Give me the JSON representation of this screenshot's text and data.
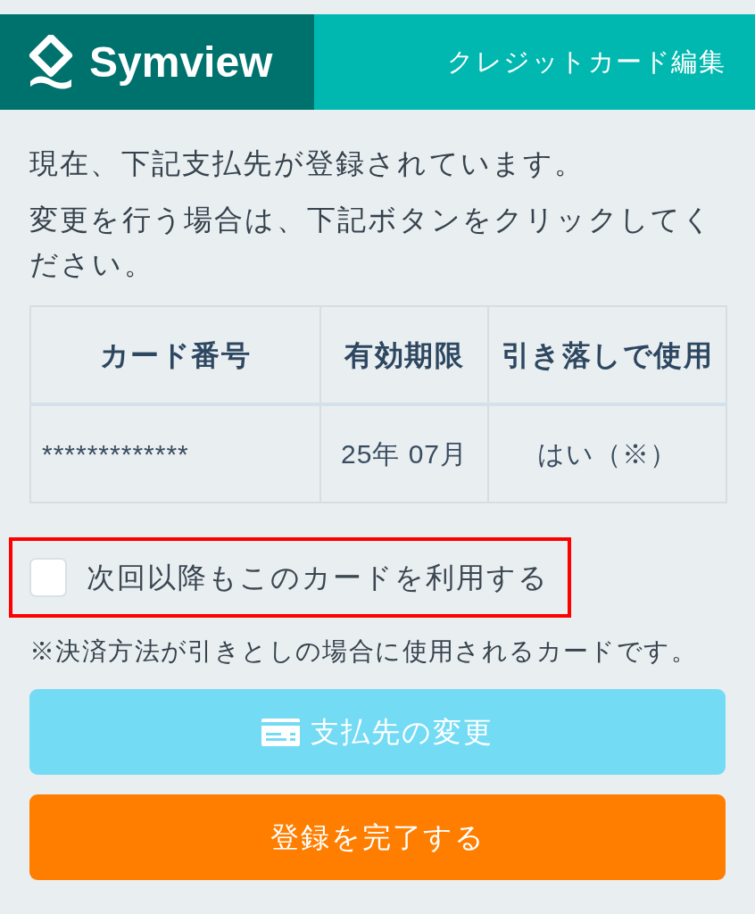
{
  "header": {
    "brand": "Symview",
    "title": "クレジットカード編集"
  },
  "intro": [
    "現在、下記支払先が登録されています。",
    "変更を行う場合は、下記ボタンをクリックしてください。"
  ],
  "table": {
    "columns": [
      "カード番号",
      "有効期限",
      "引き落しで使用"
    ],
    "rows": [
      [
        "*************",
        "25年 07月",
        "はい（※）"
      ]
    ]
  },
  "option": {
    "label": "次回以降もこのカードを利用する",
    "checked": false,
    "highlighted": true
  },
  "note": "※決済方法が引きとしの場合に使用されるカードです。",
  "buttons": [
    {
      "label": "支払先の変更",
      "kind": "change"
    },
    {
      "label": "登録を完了する",
      "kind": "complete"
    }
  ]
}
